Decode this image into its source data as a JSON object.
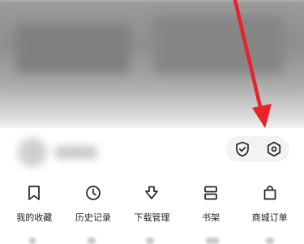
{
  "quick_actions": {
    "shield_icon": "shield-check-icon",
    "settings_icon": "settings-hexagon-icon"
  },
  "nav": [
    {
      "label": "我的收藏",
      "icon": "bookmark-icon"
    },
    {
      "label": "历史记录",
      "icon": "clock-icon"
    },
    {
      "label": "下载管理",
      "icon": "download-icon"
    },
    {
      "label": "书架",
      "icon": "bookshelf-icon"
    },
    {
      "label": "商城订单",
      "icon": "shopping-bag-icon"
    }
  ],
  "annotation": {
    "arrow_color": "#e8232b"
  }
}
